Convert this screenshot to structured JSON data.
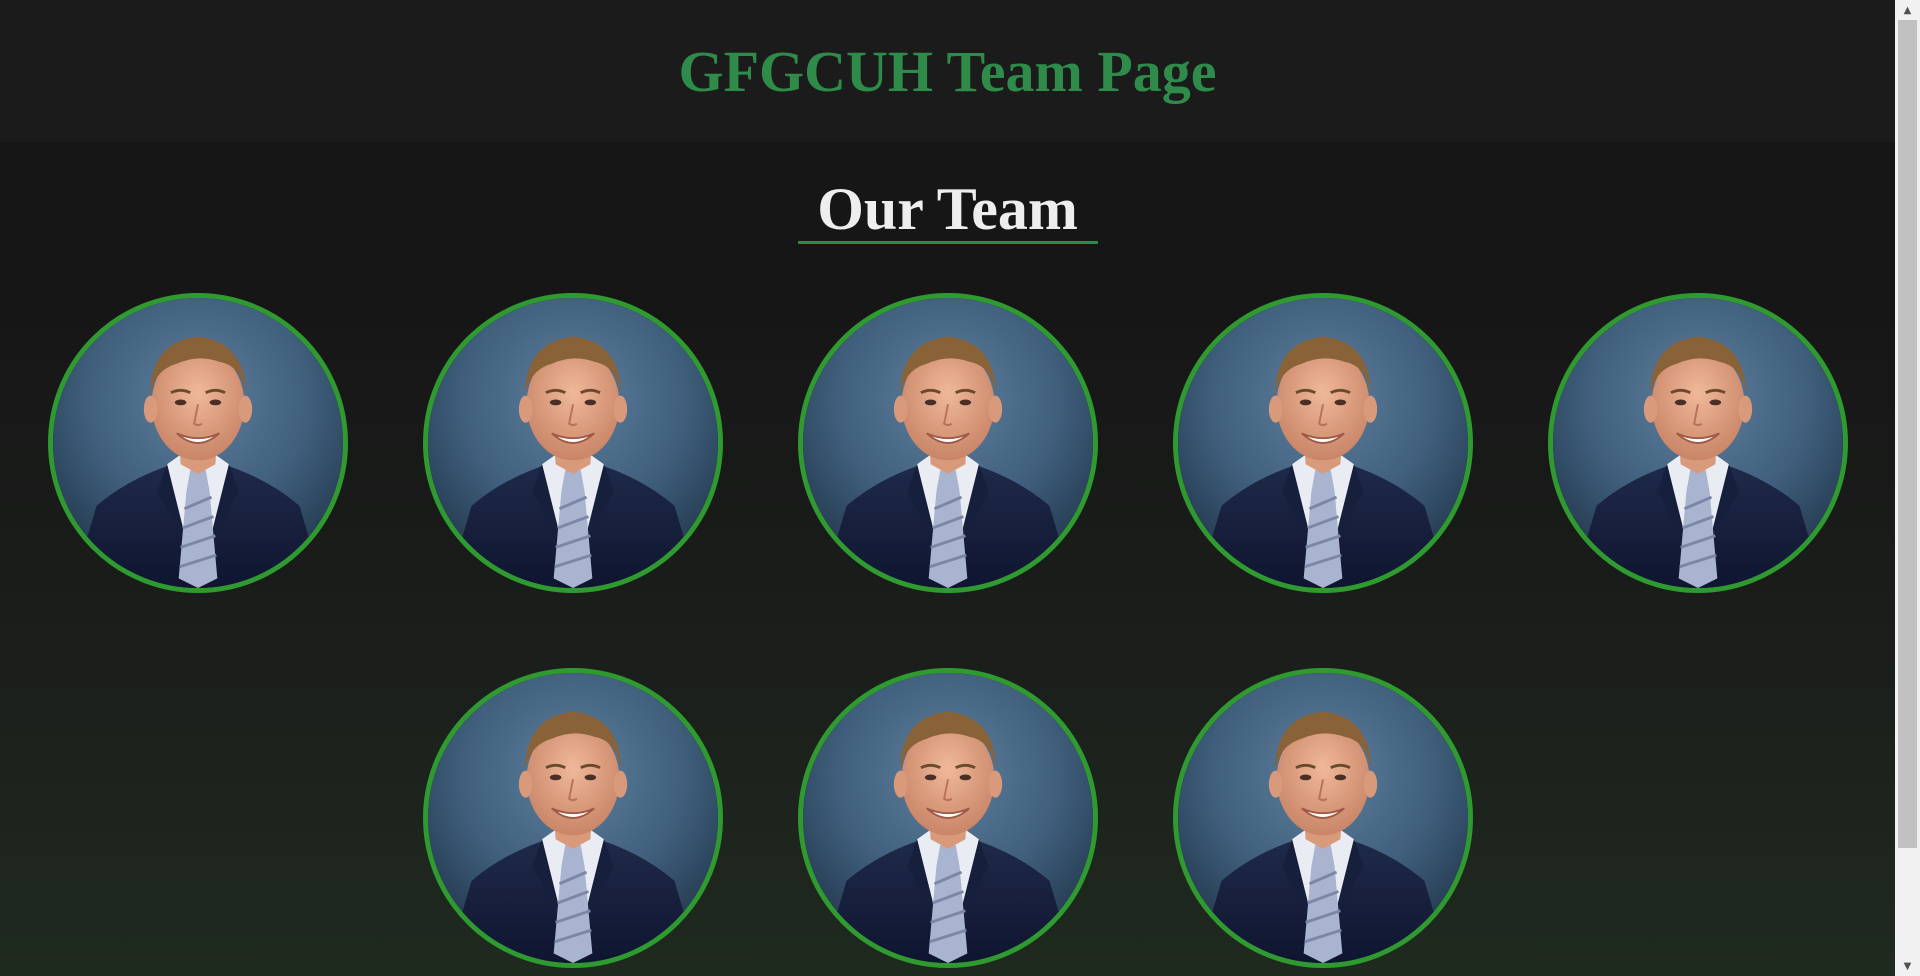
{
  "header": {
    "title": "GFGCUH Team Page"
  },
  "team": {
    "heading": "Our Team",
    "members": [
      {
        "photo": "team-member-photo"
      },
      {
        "photo": "team-member-photo"
      },
      {
        "photo": "team-member-photo"
      },
      {
        "photo": "team-member-photo"
      },
      {
        "photo": "team-member-photo"
      },
      {
        "photo": "team-member-photo"
      },
      {
        "photo": "team-member-photo"
      },
      {
        "photo": "team-member-photo"
      }
    ]
  },
  "colors": {
    "accent_green": "#2e8b4a",
    "ring_green": "#2f9a2f",
    "header_bg": "#1b1b1b",
    "page_bg": "#161616",
    "heading_text": "#eeeeee"
  },
  "icons": {
    "scroll_up": "scroll-up-arrow-icon",
    "scroll_down": "scroll-down-arrow-icon"
  }
}
